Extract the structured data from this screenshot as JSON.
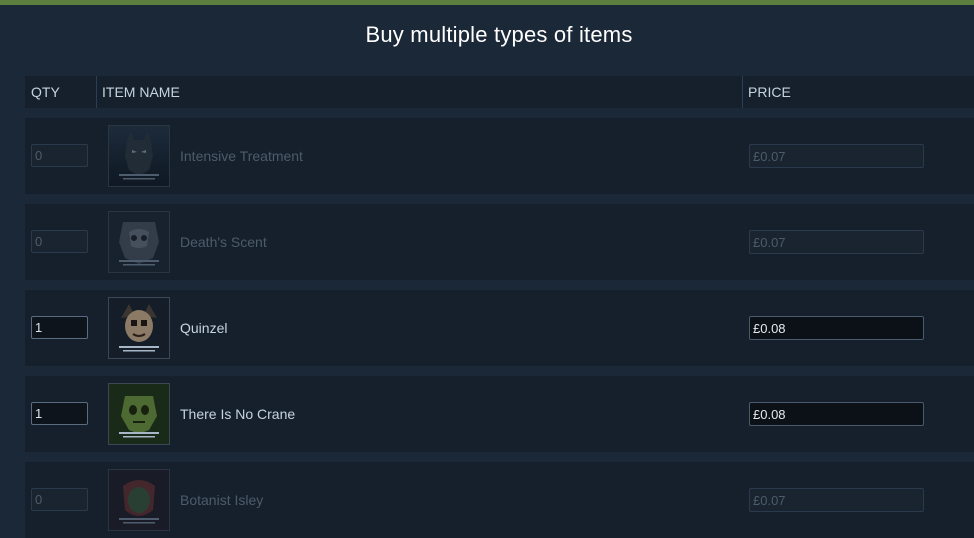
{
  "page": {
    "title": "Buy multiple types of items"
  },
  "table": {
    "headers": {
      "qty": "QTY",
      "name": "ITEM NAME",
      "price": "PRICE"
    },
    "rows": [
      {
        "qty": "0",
        "name": "Intensive Treatment",
        "price": "£0.07",
        "active": false,
        "art": "batman-icon"
      },
      {
        "qty": "0",
        "name": "Death's Scent",
        "price": "£0.07",
        "active": false,
        "art": "scarecrow-icon"
      },
      {
        "qty": "1",
        "name": "Quinzel",
        "price": "£0.08",
        "active": true,
        "art": "harley-icon"
      },
      {
        "qty": "1",
        "name": "There Is No Crane",
        "price": "£0.08",
        "active": true,
        "art": "scarecrow-mask-icon"
      },
      {
        "qty": "0",
        "name": "Botanist Isley",
        "price": "£0.07",
        "active": false,
        "art": "ivy-icon"
      }
    ]
  },
  "colors": {
    "accent": "#5c7e3e",
    "background": "#1b2838",
    "row": "#16202d"
  }
}
